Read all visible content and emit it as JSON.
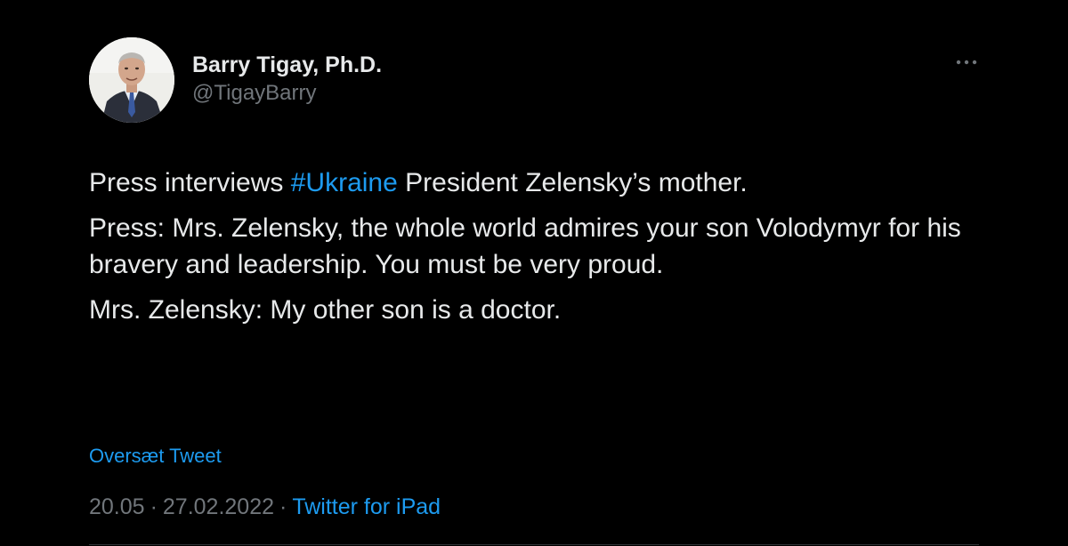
{
  "tweet": {
    "author": {
      "display_name": "Barry Tigay, Ph.D.",
      "handle": "@TigayBarry",
      "avatar_icon": "profile-photo"
    },
    "more_icon": "more-horizontal-icon",
    "paragraphs": [
      {
        "before": "Press interviews ",
        "hashtag": "#Ukraine",
        "after": " President Zelensky’s mother."
      },
      {
        "text": "Press: Mrs. Zelensky, the whole world admires your son Volodymyr for his bravery and leadership. You must be very proud."
      },
      {
        "text": "Mrs. Zelensky: My other son is a doctor."
      }
    ],
    "translate_label": "Oversæt Tweet",
    "time": "20.05",
    "date": "27.02.2022",
    "separator": "·",
    "source": "Twitter for iPad"
  },
  "colors": {
    "background": "#000000",
    "text": "#e7e9ea",
    "secondary_text": "#71767b",
    "link": "#1d9bf0"
  }
}
